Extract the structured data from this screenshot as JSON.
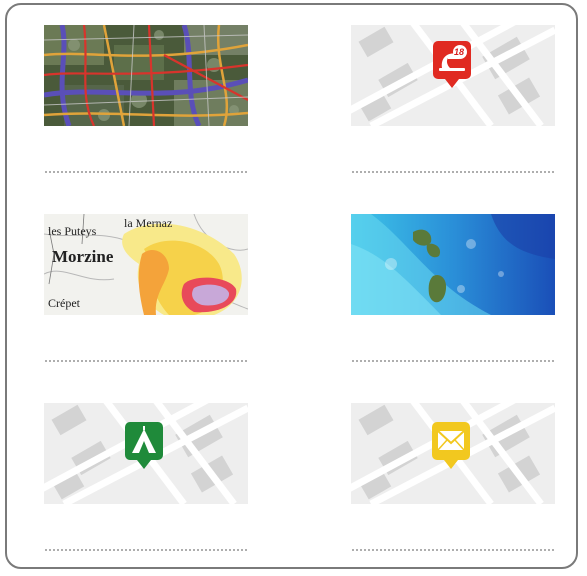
{
  "tiles": [
    {
      "name": "road-traffic-map",
      "kind": "photo-roads"
    },
    {
      "name": "fire-station-pin",
      "kind": "pin",
      "icon": "fire-helmet-icon",
      "color": "#e02a21",
      "badge": "18"
    },
    {
      "name": "avalanche-risk-map",
      "kind": "hazard",
      "labels": {
        "town1": "les Puteys",
        "town2": "la Mernaz",
        "town3": "Morzine",
        "town4": "Crépet"
      }
    },
    {
      "name": "bathymetry-map",
      "kind": "bathymetry"
    },
    {
      "name": "campsite-pin",
      "kind": "pin",
      "icon": "tent-icon",
      "color": "#1f8a3a"
    },
    {
      "name": "post-office-pin",
      "kind": "pin",
      "icon": "envelope-icon",
      "color": "#f2c81f"
    }
  ],
  "colors": {
    "border": "#7a7a7a",
    "dotted_line": "#9a9a9a",
    "map_background": "#eeeeee",
    "map_roads": "#ffffff",
    "map_blocks": "#d3d3d3"
  }
}
